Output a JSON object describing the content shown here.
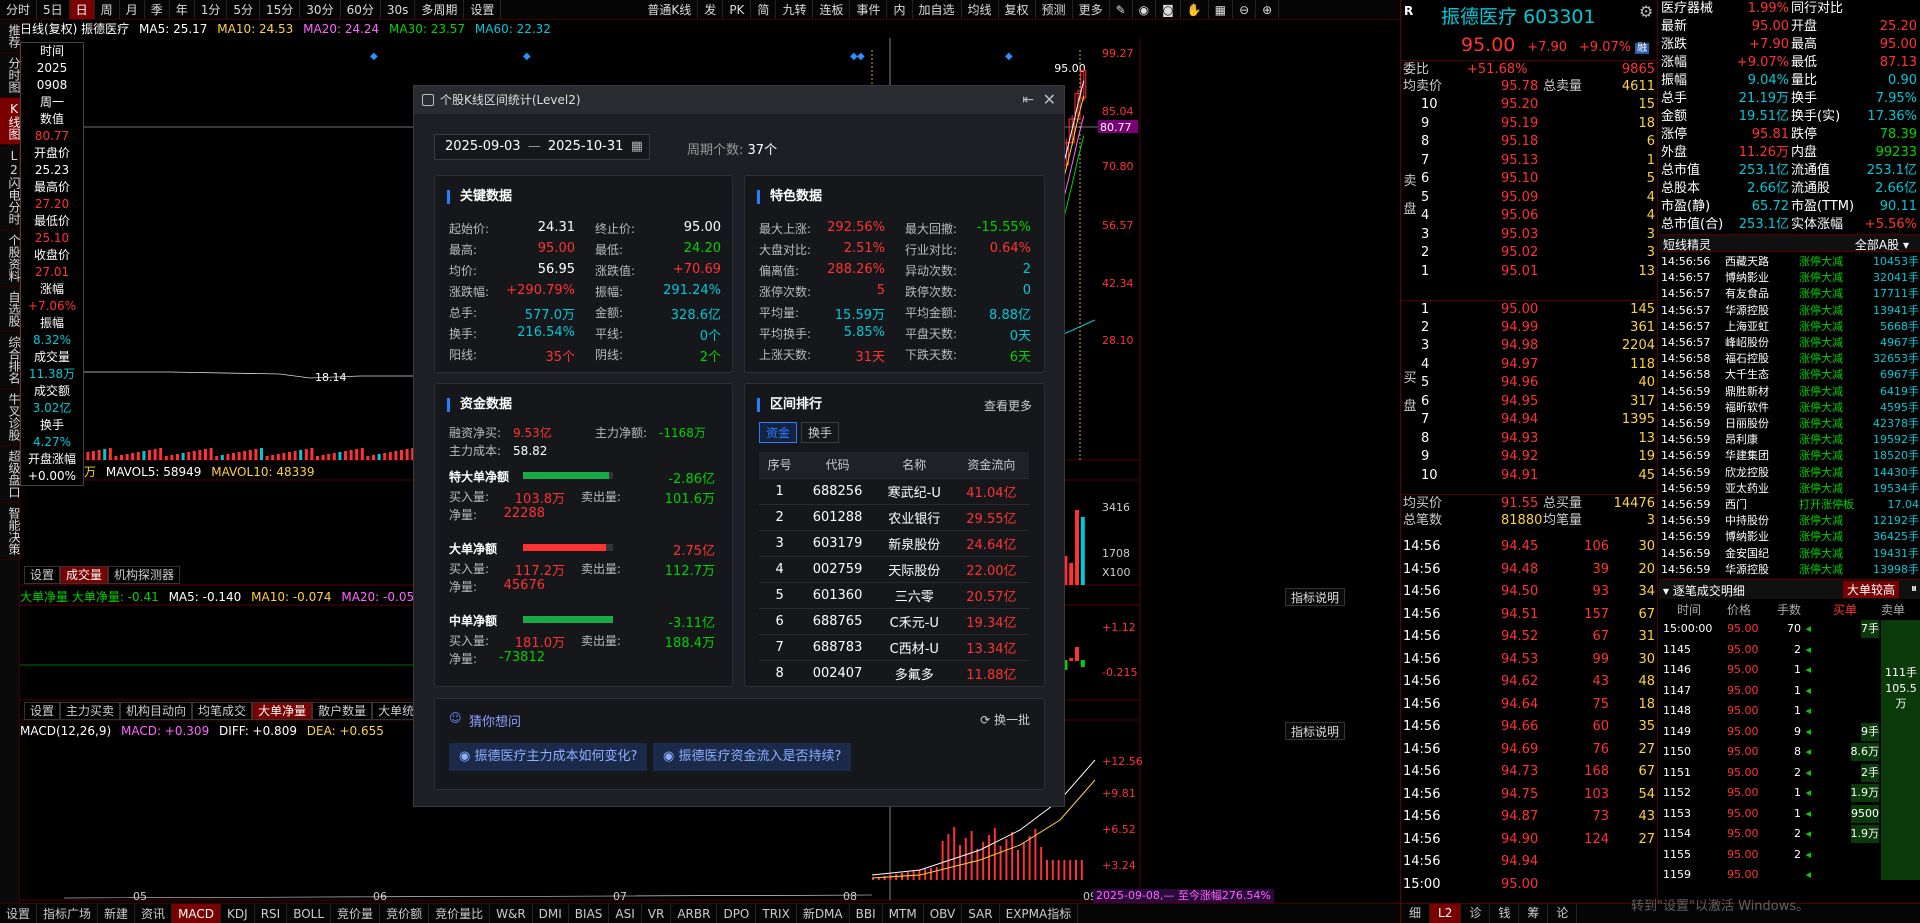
{
  "topbar": {
    "items": [
      "分时",
      "5日",
      "日",
      "周",
      "月",
      "季",
      "年",
      "1分",
      "5分",
      "15分",
      "30分",
      "60分",
      "30s",
      "多周期",
      "设置"
    ],
    "active": 2,
    "right_items": [
      "普通K线",
      "发",
      "PK",
      "简",
      "九转",
      "连板",
      "事件",
      "内",
      "加自选",
      "均线",
      "复权",
      "预测",
      "更多"
    ]
  },
  "vbar": {
    "items": [
      "推荐",
      "分时图",
      "K线图",
      "L2闪电分时",
      "个股资料",
      "自选股",
      "综合排名",
      "牛叉诊股",
      "超级盘口",
      "智能决策"
    ],
    "active": 2
  },
  "chart_title": {
    "name": "日线(复权) 振德医疗",
    "ma5": "MA5: 25.17",
    "ma10": "MA10: 24.53",
    "ma20": "MA20: 24.24",
    "ma30": "MA30: 23.57",
    "ma60": "MA60: 22.32"
  },
  "infobox": [
    {
      "label": "时间",
      "value": "2025",
      "c": "w"
    },
    {
      "label": "",
      "value": "0908",
      "c": "w"
    },
    {
      "label": "",
      "value": "周一",
      "c": "w"
    },
    {
      "label": "数值",
      "value": "80.77",
      "c": "r"
    },
    {
      "label": "开盘价",
      "value": "25.23",
      "c": "w"
    },
    {
      "label": "最高价",
      "value": "27.20",
      "c": "r"
    },
    {
      "label": "最低价",
      "value": "25.10",
      "c": "r"
    },
    {
      "label": "收盘价",
      "value": "27.01",
      "c": "r"
    },
    {
      "label": "涨幅",
      "value": "+7.06%",
      "c": "r"
    },
    {
      "label": "振幅",
      "value": "8.32%",
      "c": "c"
    },
    {
      "label": "成交量",
      "value": "11.38万",
      "c": "c"
    },
    {
      "label": "成交额",
      "value": "3.02亿",
      "c": "c"
    },
    {
      "label": "换手",
      "value": "4.27%",
      "c": "c"
    },
    {
      "label": "开盘涨幅",
      "value": "+0.00%",
      "c": "w"
    }
  ],
  "price_axis": [
    "99.27",
    "85.04",
    "80.77",
    "70.80",
    "56.57",
    "42.34",
    "28.10"
  ],
  "price_marker": "95.00",
  "low_marker": "18.14",
  "vol_line": {
    "prefix": "万",
    "mavol5": "MAVOL5: 58949",
    "mavol10": "MAVOL10: 48339"
  },
  "vol_axis": [
    "3416",
    "1708",
    "X100"
  ],
  "vol_tabs": [
    "设置",
    "成交量",
    "机构探测器"
  ],
  "flow_line": {
    "a": "大单净量 大单净量: -0.41",
    "ma5": "MA5: -0.140",
    "ma10": "MA10: -0.074",
    "ma20": "MA20: -0.05"
  },
  "flow_axis": [
    "+1.12",
    "-0.215"
  ],
  "indicator_btn": "指标说明",
  "ind_tabs": [
    "设置",
    "主力买卖",
    "机构目动向",
    "均笔成交",
    "大单净量",
    "散户数量",
    "大单统"
  ],
  "macd_line": {
    "a": "MACD(12,26,9)",
    "macd": "MACD: +0.309",
    "diff": "DIFF: +0.809",
    "dea": "DEA: +0.655"
  },
  "macd_axis": [
    "+12.56",
    "+9.81",
    "+6.52",
    "+3.24",
    "0"
  ],
  "x_months": [
    "05",
    "06",
    "07",
    "08",
    "09"
  ],
  "range_label": "2025-09-08,— 至今涨幅276.54%",
  "bottombar": [
    "设置",
    "指标广场",
    "新建",
    "资讯",
    "MACD",
    "KDJ",
    "RSI",
    "BOLL",
    "竞价量",
    "竞价额",
    "竞价量比",
    "W&R",
    "DMI",
    "BIAS",
    "ASI",
    "VR",
    "ARBR",
    "DPO",
    "TRIX",
    "新DMA",
    "BBI",
    "MTM",
    "OBV",
    "SAR",
    "EXPMA指标"
  ],
  "bottombar_active": 4,
  "dialog": {
    "title": "个股K线区间统计(Level2)",
    "start": "2025-09-03",
    "end": "2025-10-31",
    "sep": "—",
    "period_label": "周期个数:",
    "period_value": "37个",
    "key": {
      "title": "关键数据",
      "rows": [
        [
          "起始价:",
          "24.31",
          "w",
          "终止价:",
          "95.00",
          "w"
        ],
        [
          "最高:",
          "95.00",
          "r",
          "最低:",
          "24.20",
          "g"
        ],
        [
          "均价:",
          "56.95",
          "w",
          "涨跌值:",
          "+70.69",
          "r"
        ],
        [
          "涨跌幅:",
          "+290.79%",
          "r",
          "振幅:",
          "291.24%",
          "c"
        ],
        [
          "总手:",
          "577.0万",
          "c",
          "金额:",
          "328.6亿",
          "c"
        ],
        [
          "换手:",
          "216.54%",
          "c",
          "平线:",
          "0个",
          "c"
        ],
        [
          "阳线:",
          "35个",
          "r",
          "阴线:",
          "2个",
          "g"
        ]
      ]
    },
    "feature": {
      "title": "特色数据",
      "rows": [
        [
          "最大上涨:",
          "292.56%",
          "r",
          "最大回撤:",
          "-15.55%",
          "g"
        ],
        [
          "大盘对比:",
          "2.51%",
          "r",
          "行业对比:",
          "0.64%",
          "r"
        ],
        [
          "偏离值:",
          "288.26%",
          "r",
          "异动次数:",
          "2",
          "c"
        ],
        [
          "涨停次数:",
          "5",
          "r",
          "跌停次数:",
          "0",
          "c"
        ],
        [
          "平均量:",
          "15.59万",
          "c",
          "平均金额:",
          "8.88亿",
          "c"
        ],
        [
          "平均换手:",
          "5.85%",
          "c",
          "平盘天数:",
          "0天",
          "c"
        ],
        [
          "上涨天数:",
          "31天",
          "r",
          "下跌天数:",
          "6天",
          "g"
        ]
      ]
    },
    "fund": {
      "title": "资金数据",
      "rzmr_k": "融资净买:",
      "rzmr_v": "9.53亿",
      "zljl_k": "主力净额:",
      "zljl_v": "-1168万",
      "zlcb_k": "主力成本:",
      "zlcb_v": "58.82",
      "groups": [
        {
          "name": "特大单净额",
          "value": "-2.86亿",
          "vc": "g",
          "buy": "103.8万",
          "sell": "101.6万",
          "net": "22288",
          "nc": "r",
          "bar": "g",
          "fill": 0.95
        },
        {
          "name": "大单净额",
          "value": "2.75亿",
          "vc": "r",
          "buy": "117.2万",
          "sell": "112.7万",
          "net": "45676",
          "nc": "r",
          "bar": "r",
          "fill": 0.92
        },
        {
          "name": "中单净额",
          "value": "-3.11亿",
          "vc": "g",
          "buy": "181.0万",
          "sell": "188.4万",
          "net": "-73812",
          "nc": "g",
          "bar": "g",
          "fill": 1.0
        }
      ],
      "buy_k": "买入量:",
      "sell_k": "卖出量:",
      "net_k": "净量:"
    },
    "rank": {
      "title": "区间排行",
      "more": "查看更多",
      "tabs": [
        "资金",
        "换手"
      ],
      "headers": [
        "序号",
        "代码",
        "名称",
        "资金流向"
      ],
      "rows": [
        [
          "1",
          "688256",
          "寒武纪-U",
          "41.04亿"
        ],
        [
          "2",
          "601288",
          "农业银行",
          "29.55亿"
        ],
        [
          "3",
          "603179",
          "新泉股份",
          "24.64亿"
        ],
        [
          "4",
          "002759",
          "天际股份",
          "22.00亿"
        ],
        [
          "5",
          "601360",
          "三六零",
          "20.57亿"
        ],
        [
          "6",
          "688765",
          "C禾元-U",
          "19.34亿"
        ],
        [
          "7",
          "688783",
          "C西材-U",
          "13.34亿"
        ],
        [
          "8",
          "002407",
          "多氟多",
          "11.88亿"
        ]
      ]
    },
    "guess": {
      "title": "猜你想问",
      "refresh": "换一批",
      "q1": "振德医疗主力成本如何变化?",
      "q2": "振德医疗资金流入是否持续?"
    }
  },
  "quote": {
    "name": "振德医疗",
    "code": "603301",
    "price": "95.00",
    "chg": "+7.90",
    "pct": "+9.07%",
    "tag": "R",
    "rong": "融",
    "weibi_k": "委比",
    "weibi_v": "+51.68%",
    "weibi_n": "9865",
    "junjia_k": "均卖价",
    "junjia_v": "95.78",
    "zml_k": "总卖量",
    "zml_v": "4611",
    "sell": [
      [
        "10",
        "95.20",
        "15"
      ],
      [
        "9",
        "95.19",
        "18"
      ],
      [
        "8",
        "95.18",
        "6"
      ],
      [
        "7",
        "95.13",
        "1"
      ],
      [
        "6",
        "95.10",
        "5"
      ],
      [
        "5",
        "95.09",
        "4"
      ],
      [
        "4",
        "95.06",
        "4"
      ],
      [
        "3",
        "95.03",
        "3"
      ],
      [
        "2",
        "95.02",
        "3"
      ],
      [
        "1",
        "95.01",
        "13"
      ]
    ],
    "buy": [
      [
        "1",
        "95.00",
        "145"
      ],
      [
        "2",
        "94.99",
        "361"
      ],
      [
        "3",
        "94.98",
        "2204"
      ],
      [
        "4",
        "94.97",
        "118"
      ],
      [
        "5",
        "94.96",
        "40"
      ],
      [
        "6",
        "94.95",
        "317"
      ],
      [
        "7",
        "94.94",
        "1395"
      ],
      [
        "8",
        "94.93",
        "13"
      ],
      [
        "9",
        "94.92",
        "19"
      ],
      [
        "10",
        "94.91",
        "45"
      ]
    ],
    "sell_side_label": "卖盘",
    "buy_side_label": "买盘",
    "jmj_k": "均买价",
    "jmj_v": "91.55",
    "zml2_k": "总买量",
    "zml2_v": "14476",
    "zbs_k": "总笔数",
    "zbs_v": "81880",
    "jbl_k": "均笔量",
    "jbl_v": "3",
    "ticks": [
      [
        "14:56",
        "94.45",
        "106",
        "30"
      ],
      [
        "14:56",
        "94.48",
        "39",
        "20"
      ],
      [
        "14:56",
        "94.50",
        "93",
        "34"
      ],
      [
        "14:56",
        "94.51",
        "157",
        "67"
      ],
      [
        "14:56",
        "94.52",
        "67",
        "31"
      ],
      [
        "14:56",
        "94.53",
        "99",
        "30"
      ],
      [
        "14:56",
        "94.62",
        "43",
        "48"
      ],
      [
        "14:56",
        "94.64",
        "75",
        "18"
      ],
      [
        "14:56",
        "94.66",
        "60",
        "35"
      ],
      [
        "14:56",
        "94.69",
        "76",
        "27"
      ],
      [
        "14:56",
        "94.73",
        "168",
        "67"
      ],
      [
        "14:56",
        "94.75",
        "103",
        "54"
      ],
      [
        "14:56",
        "94.87",
        "73",
        "43"
      ],
      [
        "14:56",
        "94.90",
        "124",
        "27"
      ],
      [
        "14:56",
        "94.94",
        "",
        ""
      ],
      [
        "15:00",
        "95.00",
        "",
        ""
      ]
    ]
  },
  "stats": {
    "rows": [
      [
        "医疗器械",
        "1.99%",
        "r",
        "同行对比",
        "",
        "w"
      ],
      [
        "最新",
        "95.00",
        "r",
        "开盘",
        "25.20",
        "r"
      ],
      [
        "涨跌",
        "+7.90",
        "r",
        "最高",
        "95.00",
        "r"
      ],
      [
        "涨幅",
        "+9.07%",
        "r",
        "最低",
        "87.13",
        "r"
      ],
      [
        "振幅",
        "9.04%",
        "c",
        "量比",
        "0.90",
        "c"
      ],
      [
        "总手",
        "21.19万",
        "c",
        "换手",
        "7.95%",
        "c"
      ],
      [
        "金额",
        "19.51亿",
        "c",
        "换手(实)",
        "17.36%",
        "c"
      ],
      [
        "涨停",
        "95.81",
        "r",
        "跌停",
        "78.39",
        "g"
      ],
      [
        "外盘",
        "11.26万",
        "r",
        "内盘",
        "99233",
        "g"
      ],
      [
        "总市值",
        "253.1亿",
        "c",
        "流通值",
        "253.1亿",
        "c"
      ],
      [
        "总股本",
        "2.66亿",
        "c",
        "流通股",
        "2.66亿",
        "c"
      ],
      [
        "市盈(静)",
        "65.72",
        "c",
        "市盈(TTM)",
        "90.11",
        "c"
      ],
      [
        "总市值(合)",
        "253.1亿",
        "c",
        "实体涨幅",
        "+5.56%",
        "r"
      ]
    ],
    "short_title": "短线精灵",
    "short_filter": "全部A股",
    "short": [
      [
        "14:56:56",
        "西藏天路",
        "涨停大减",
        "10453手"
      ],
      [
        "14:56:57",
        "博纳影业",
        "涨停大减",
        "32041手"
      ],
      [
        "14:56:57",
        "有友食品",
        "涨停大减",
        "17711手"
      ],
      [
        "14:56:57",
        "华源控股",
        "涨停大减",
        "13941手"
      ],
      [
        "14:56:57",
        "上海亚虹",
        "涨停大减",
        "5668手"
      ],
      [
        "14:56:57",
        "峰岹股份",
        "涨停大减",
        "4967手"
      ],
      [
        "14:56:58",
        "福石控股",
        "涨停大减",
        "32653手"
      ],
      [
        "14:56:58",
        "大千生态",
        "涨停大减",
        "6967手"
      ],
      [
        "14:56:59",
        "鼎胜新材",
        "涨停大减",
        "6419手"
      ],
      [
        "14:56:59",
        "福昕软件",
        "涨停大减",
        "4595手"
      ],
      [
        "14:56:59",
        "日丽股份",
        "涨停大减",
        "42378手"
      ],
      [
        "14:56:59",
        "昂利康",
        "涨停大减",
        "19592手"
      ],
      [
        "14:56:59",
        "华建集团",
        "涨停大减",
        "18520手"
      ],
      [
        "14:56:59",
        "欣龙控股",
        "涨停大减",
        "14430手"
      ],
      [
        "14:56:59",
        "亚太药业",
        "涨停大减",
        "19534手"
      ],
      [
        "14:56:59",
        "西门",
        "打开涨停板",
        "17.04"
      ],
      [
        "14:56:59",
        "中持股份",
        "涨停大减",
        "12192手"
      ],
      [
        "14:56:59",
        "博纳影业",
        "涨停大减",
        "36425手"
      ],
      [
        "14:56:59",
        "金安国纪",
        "涨停大减",
        "19431手"
      ],
      [
        "14:56:59",
        "华源控股",
        "涨停大减",
        "13998手"
      ]
    ],
    "tick_title": "逐笔成交明细",
    "big_btn": "大单较高",
    "tick_headers": [
      "时间",
      "价格",
      "手数",
      "买单",
      "卖单"
    ],
    "ticks2": [
      [
        "15:00:00",
        "95.00",
        "70",
        "7手",
        ""
      ],
      [
        "1145",
        "95.00",
        "2",
        "",
        ""
      ],
      [
        "1146",
        "95.00",
        "1",
        "",
        ""
      ],
      [
        "1147",
        "95.00",
        "1",
        "",
        ""
      ],
      [
        "1148",
        "95.00",
        "1",
        "",
        ""
      ],
      [
        "1149",
        "95.00",
        "9",
        "9手",
        ""
      ],
      [
        "1150",
        "95.00",
        "8",
        "8.6万",
        ""
      ],
      [
        "1151",
        "95.00",
        "2",
        "2手",
        ""
      ],
      [
        "1152",
        "95.00",
        "1",
        "1.9万",
        ""
      ],
      [
        "1153",
        "95.00",
        "1",
        "9500",
        ""
      ],
      [
        "1154",
        "95.00",
        "2",
        "1.9万",
        ""
      ],
      [
        "1155",
        "95.00",
        "2",
        "",
        ""
      ],
      [
        "1159",
        "95.00",
        "",
        "",
        ""
      ]
    ],
    "side_big": "111手",
    "side_big2": "105.5万"
  },
  "right_bottom_tabs": [
    "细",
    "L2",
    "诊",
    "钱",
    "筹",
    "论"
  ],
  "watermark": "转到\"设置\"以激活 Windows。",
  "colors": {
    "up": "#ff3232",
    "down": "#00d200",
    "accent": "#2a7fff",
    "panel": "#1e1f24"
  }
}
